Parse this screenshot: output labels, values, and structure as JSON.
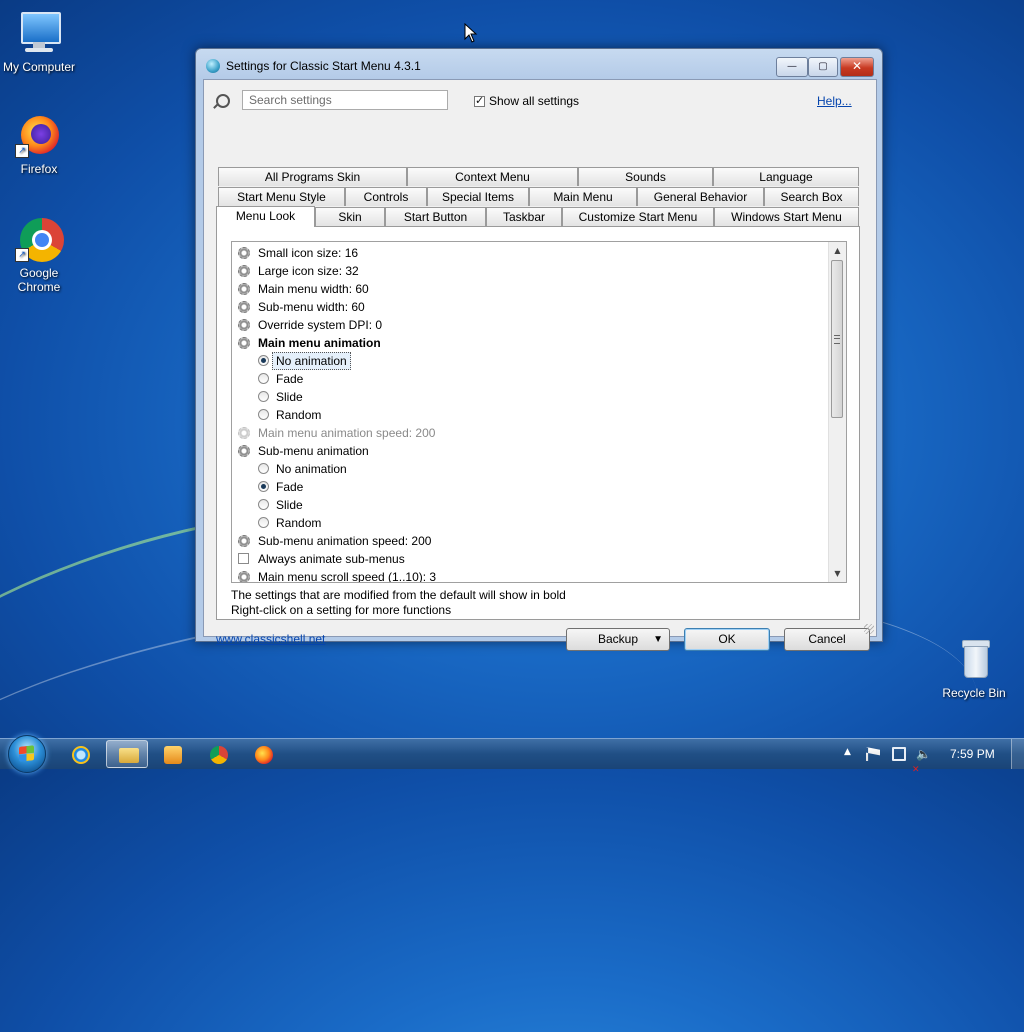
{
  "desktop": {
    "icons": [
      {
        "label": "My Computer"
      },
      {
        "label": "Firefox"
      },
      {
        "label": "Google Chrome"
      },
      {
        "label": "Recycle Bin"
      }
    ]
  },
  "window": {
    "title": "Settings for Classic Start Menu 4.3.1",
    "controls": {
      "minimize": "—",
      "maximize": "▢",
      "close": "✕"
    },
    "search": {
      "placeholder": "Search settings",
      "value": ""
    },
    "show_all_settings": {
      "label": "Show all settings",
      "checked": true
    },
    "help_link": "Help...",
    "tabs": {
      "row1": [
        "All Programs Skin",
        "Context Menu",
        "Sounds",
        "Language"
      ],
      "row2": [
        "Start Menu Style",
        "Controls",
        "Special Items",
        "Main Menu",
        "General Behavior",
        "Search Box"
      ],
      "row3": [
        "Menu Look",
        "Skin",
        "Start Button",
        "Taskbar",
        "Customize Start Menu",
        "Windows Start Menu"
      ],
      "active": "Menu Look"
    },
    "settings": [
      {
        "kind": "setting",
        "text": "Small icon size: 16"
      },
      {
        "kind": "setting",
        "text": "Large icon size: 32"
      },
      {
        "kind": "setting",
        "text": "Main menu width: 60"
      },
      {
        "kind": "setting",
        "text": "Sub-menu width: 60"
      },
      {
        "kind": "setting",
        "text": "Override system DPI: 0"
      },
      {
        "kind": "setting",
        "text": "Main menu animation",
        "bold": true
      },
      {
        "kind": "radio",
        "text": "No animation",
        "checked": true,
        "selected": true
      },
      {
        "kind": "radio",
        "text": "Fade",
        "checked": false
      },
      {
        "kind": "radio",
        "text": "Slide",
        "checked": false
      },
      {
        "kind": "radio",
        "text": "Random",
        "checked": false
      },
      {
        "kind": "setting",
        "text": "Main menu animation speed: 200",
        "disabled": true
      },
      {
        "kind": "setting",
        "text": "Sub-menu animation"
      },
      {
        "kind": "radio",
        "text": "No animation",
        "checked": false
      },
      {
        "kind": "radio",
        "text": "Fade",
        "checked": true
      },
      {
        "kind": "radio",
        "text": "Slide",
        "checked": false
      },
      {
        "kind": "radio",
        "text": "Random",
        "checked": false
      },
      {
        "kind": "setting",
        "text": "Sub-menu animation speed: 200"
      },
      {
        "kind": "checkbox",
        "text": "Always animate sub-menus",
        "checked": false
      },
      {
        "kind": "setting",
        "text": "Main menu scroll speed (1..10): 3"
      }
    ],
    "hints": [
      "The settings that are modified from the default will show in bold",
      "Right-click on a setting for more functions"
    ],
    "website_link": "www.classicshell.net",
    "buttons": {
      "backup": "Backup",
      "ok": "OK",
      "cancel": "Cancel"
    }
  },
  "taskbar": {
    "clock": "7:59 PM"
  }
}
